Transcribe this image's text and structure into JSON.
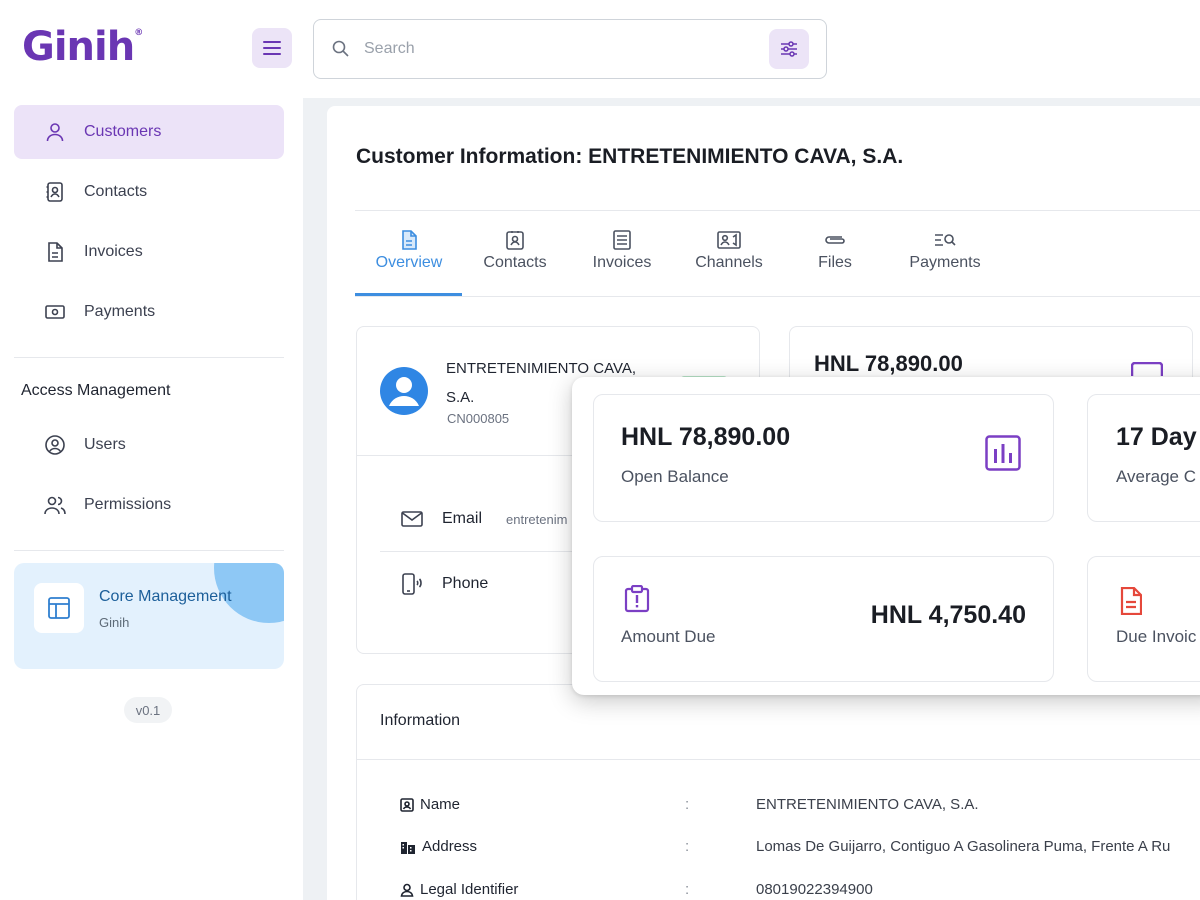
{
  "app": {
    "logo": "Ginih",
    "logo_mark": "®"
  },
  "search": {
    "placeholder": "Search",
    "value": ""
  },
  "sidebar": {
    "items": [
      {
        "label": "Customers",
        "icon": "user-icon",
        "active": true
      },
      {
        "label": "Contacts",
        "icon": "contact-card-icon"
      },
      {
        "label": "Invoices",
        "icon": "document-icon"
      },
      {
        "label": "Payments",
        "icon": "money-icon"
      }
    ],
    "access_section": "Access Management",
    "access_items": [
      {
        "label": "Users",
        "icon": "user-circle-icon"
      },
      {
        "label": "Permissions",
        "icon": "users-icon"
      }
    ],
    "core": {
      "title": "Core Management",
      "subtitle": "Ginih"
    },
    "version": "v0.1"
  },
  "page": {
    "title": "Customer Information: ENTRETENIMIENTO CAVA, S.A.",
    "tabs": [
      {
        "label": "Overview",
        "icon": "document-icon",
        "active": true
      },
      {
        "label": "Contacts",
        "icon": "contact-card-icon"
      },
      {
        "label": "Invoices",
        "icon": "list-icon"
      },
      {
        "label": "Channels",
        "icon": "channel-icon"
      },
      {
        "label": "Files",
        "icon": "paperclip-icon"
      },
      {
        "label": "Payments",
        "icon": "search-list-icon"
      }
    ]
  },
  "customer": {
    "name": "ENTRETENIMIENTO CAVA, S.A.",
    "code": "CN000805",
    "email_label": "Email",
    "email_value": "entretenim",
    "phone_label": "Phone"
  },
  "balance_peek": "HNL 78,890.00",
  "stats": {
    "open_balance": {
      "value": "HNL 78,890.00",
      "label": "Open Balance",
      "icon": "bar-chart-icon"
    },
    "average": {
      "value": "17 Day",
      "label": "Average C"
    },
    "amount_due": {
      "value": "HNL 4,750.40",
      "label": "Amount Due",
      "icon": "clipboard-alert-icon"
    },
    "due_invoices": {
      "label": "Due Invoic",
      "icon": "invoice-icon"
    }
  },
  "information": {
    "title": "Information",
    "rows": [
      {
        "key": "Name",
        "icon": "id-badge-icon",
        "value": "ENTRETENIMIENTO CAVA, S.A."
      },
      {
        "key": "Address",
        "icon": "building-icon",
        "value": "Lomas De Guijarro, Contiguo A Gasolinera Puma, Frente A Ru"
      },
      {
        "key": "Legal Identifier",
        "icon": "person-icon",
        "value": "08019022394900"
      }
    ],
    "separator": ":"
  },
  "colors": {
    "brand": "#6a36b3",
    "accent_blue": "#3d8ee0",
    "active_bg": "#ece3f8",
    "stat_purple": "#7b3fc4",
    "invoice_red": "#e5483b"
  }
}
